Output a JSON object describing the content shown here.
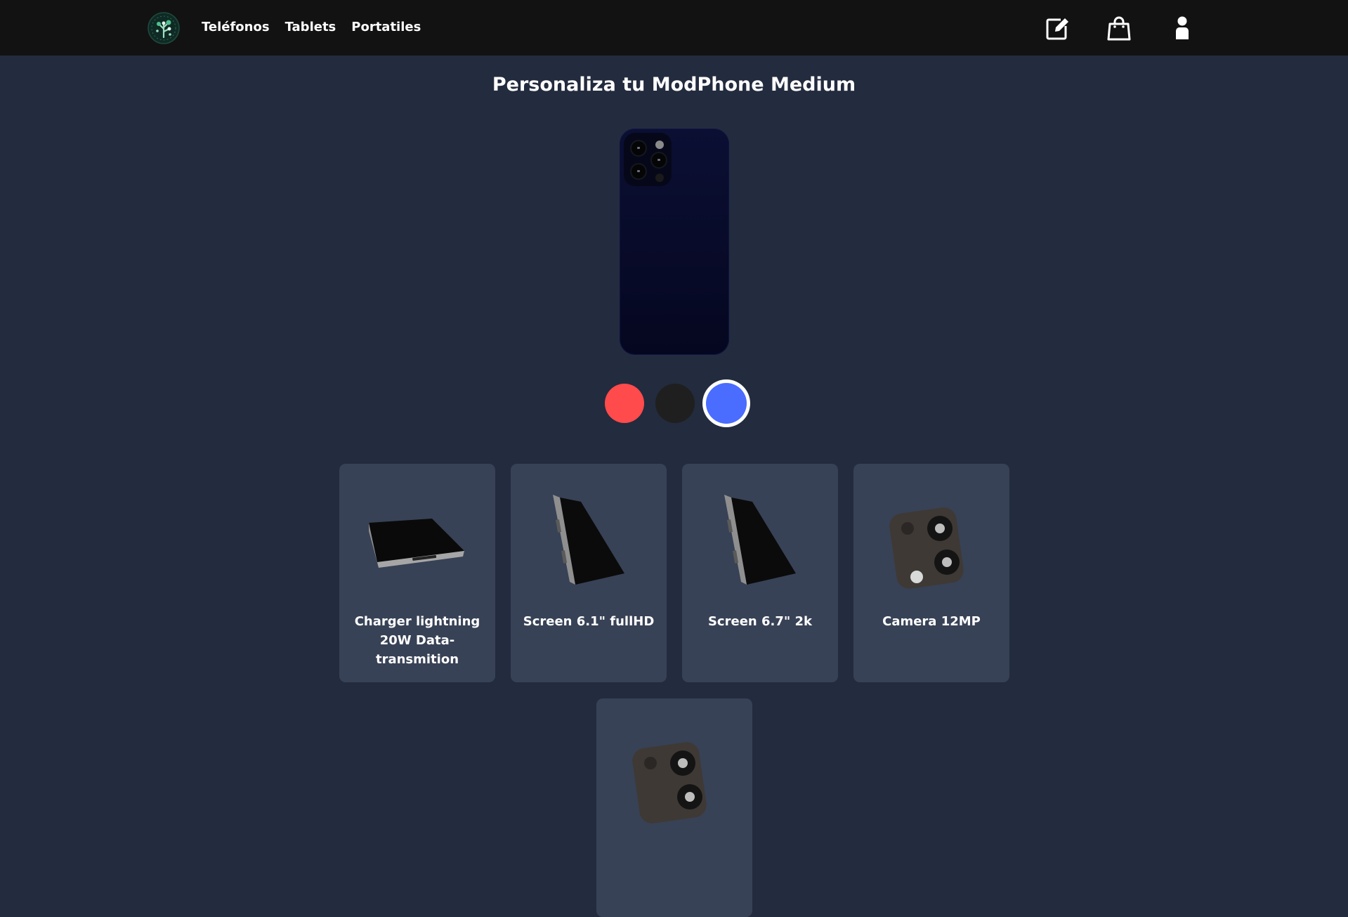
{
  "header": {
    "nav": [
      "Teléfonos",
      "Tablets",
      "Portatiles"
    ],
    "icons": [
      "logo-icon",
      "edit-icon",
      "shopping-bag-icon",
      "user-icon"
    ]
  },
  "main": {
    "title": "Personaliza tu ModPhone Medium",
    "phone_color": "#0a0e30",
    "colors": [
      {
        "name": "red",
        "hex": "#ff4b4b",
        "selected": false
      },
      {
        "name": "black",
        "hex": "#1f1f1f",
        "selected": false
      },
      {
        "name": "blue",
        "hex": "#4a6cff",
        "selected": true
      }
    ],
    "components": [
      {
        "label": "Charger lightning 20W Data-transmition",
        "icon": "charger-icon"
      },
      {
        "label": "Screen 6.1\" fullHD",
        "icon": "screen-icon"
      },
      {
        "label": "Screen 6.7\" 2k",
        "icon": "screen-icon"
      },
      {
        "label": "Camera 12MP",
        "icon": "camera-module-icon"
      },
      {
        "label": "",
        "icon": "camera-module-icon"
      }
    ]
  }
}
